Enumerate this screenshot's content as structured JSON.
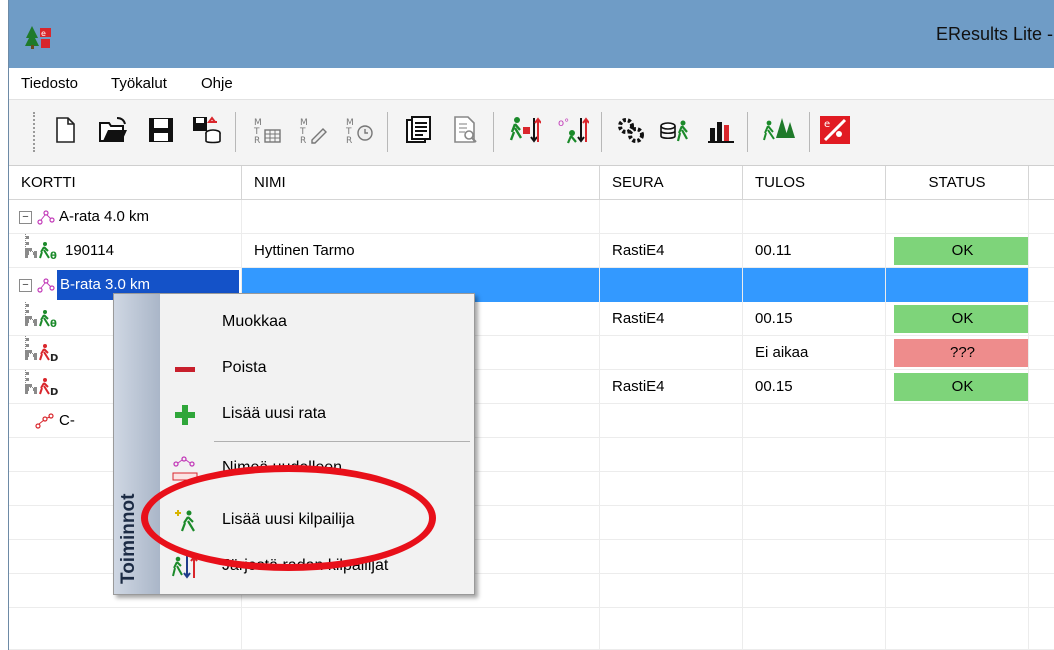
{
  "window": {
    "title": "EResults Lite -"
  },
  "menu": [
    "Tiedosto",
    "Työkalut",
    "Ohje"
  ],
  "toolbar": {
    "buttons": [
      {
        "icon": "new-file-icon"
      },
      {
        "icon": "open-folder-icon"
      },
      {
        "icon": "save-icon"
      },
      {
        "icon": "export-db-icon"
      },
      {
        "icon": "course-table-icon"
      },
      {
        "icon": "course-edit-icon"
      },
      {
        "icon": "course-time-icon"
      },
      {
        "icon": "print-icon"
      },
      {
        "icon": "print-preview-icon"
      },
      {
        "icon": "sort-results-icon"
      },
      {
        "icon": "sort-course-icon"
      },
      {
        "icon": "settings-gears-icon"
      },
      {
        "icon": "db-runner-icon"
      },
      {
        "icon": "bar-chart-icon"
      },
      {
        "icon": "runners-forest-icon"
      },
      {
        "icon": "eresults-logo-icon"
      }
    ]
  },
  "grid": {
    "columns": [
      "KORTTI",
      "NIMI",
      "SEURA",
      "TULOS",
      "STATUS"
    ],
    "rows": [
      {
        "type": "course",
        "kortti": "A-rata 4.0 km",
        "nimi": "",
        "seura": "",
        "tulos": "",
        "status": "",
        "status_kind": "none"
      },
      {
        "type": "competitor",
        "kortti": "190114",
        "nimi": "Hyttinen Tarmo",
        "seura": "RastiE4",
        "tulos": "00.11",
        "status": "OK",
        "status_kind": "ok"
      },
      {
        "type": "course-selected",
        "kortti": "B-rata 3.0 km",
        "nimi": "",
        "seura": "",
        "tulos": "",
        "status": "",
        "status_kind": "none"
      },
      {
        "type": "competitor",
        "kortti": "",
        "nimi": "",
        "seura": "RastiE4",
        "tulos": "00.15",
        "status": "OK",
        "status_kind": "ok"
      },
      {
        "type": "competitor",
        "kortti": "",
        "nimi": "",
        "seura": "",
        "tulos": "Ei aikaa",
        "status": "???",
        "status_kind": "bad"
      },
      {
        "type": "competitor",
        "kortti": "",
        "nimi": "",
        "seura": "RastiE4",
        "tulos": "00.15",
        "status": "OK",
        "status_kind": "ok"
      },
      {
        "type": "course",
        "kortti": "C-",
        "nimi": "",
        "seura": "",
        "tulos": "",
        "status": "",
        "status_kind": "none"
      }
    ]
  },
  "context_menu": {
    "title": "Toiminnot",
    "items": [
      {
        "label": "Muokkaa",
        "icon": "none"
      },
      {
        "label": "Poista",
        "icon": "minus-icon"
      },
      {
        "label": "Lisää uusi rata",
        "icon": "plus-icon"
      },
      {
        "label": "Nimeä uudelleen",
        "icon": "rename-course-icon"
      },
      {
        "label": "Lisää uusi kilpailija",
        "icon": "add-competitor-icon"
      },
      {
        "label": "Järjestä radan kilpailijat",
        "icon": "sort-competitors-icon"
      }
    ]
  },
  "colors": {
    "title_bar": "#6f9cc6",
    "selection": "#3399ff",
    "ok": "#7ed47a",
    "bad": "#ee8c8c",
    "highlight": "#e8101a"
  }
}
